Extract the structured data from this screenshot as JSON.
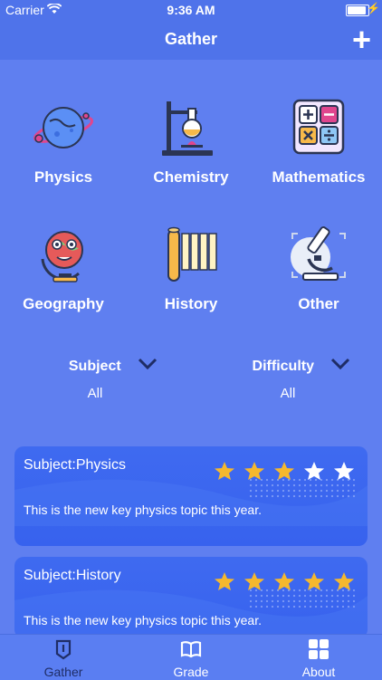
{
  "status": {
    "carrier": "Carrier",
    "time": "9:36 AM"
  },
  "nav": {
    "title": "Gather",
    "add": "+"
  },
  "subjects": [
    {
      "label": "Physics",
      "icon": "planet-icon"
    },
    {
      "label": "Chemistry",
      "icon": "flask-icon"
    },
    {
      "label": "Mathematics",
      "icon": "calculator-icon"
    },
    {
      "label": "Geography",
      "icon": "globe-icon"
    },
    {
      "label": "History",
      "icon": "scroll-icon"
    },
    {
      "label": "Other",
      "icon": "microscope-icon"
    }
  ],
  "filters": {
    "subject": {
      "label": "Subject",
      "value": "All"
    },
    "difficulty": {
      "label": "Difficulty",
      "value": "All"
    }
  },
  "cards": [
    {
      "subject": "Subject:Physics",
      "desc": "This is the new key physics topic this year.",
      "rating": 3,
      "max": 5
    },
    {
      "subject": "Subject:History",
      "desc": "This is the new key physics topic this year.",
      "rating": 5,
      "max": 5
    }
  ],
  "tabs": [
    {
      "label": "Gather",
      "icon": "gather-icon",
      "active": true
    },
    {
      "label": "Grade",
      "icon": "book-icon",
      "active": false
    },
    {
      "label": "About",
      "icon": "grid-icon",
      "active": false
    }
  ],
  "colors": {
    "accent": "#4f73ea",
    "star_on": "#f5b82e",
    "star_off": "#ffffff",
    "active_tab": "#1f2d66"
  }
}
